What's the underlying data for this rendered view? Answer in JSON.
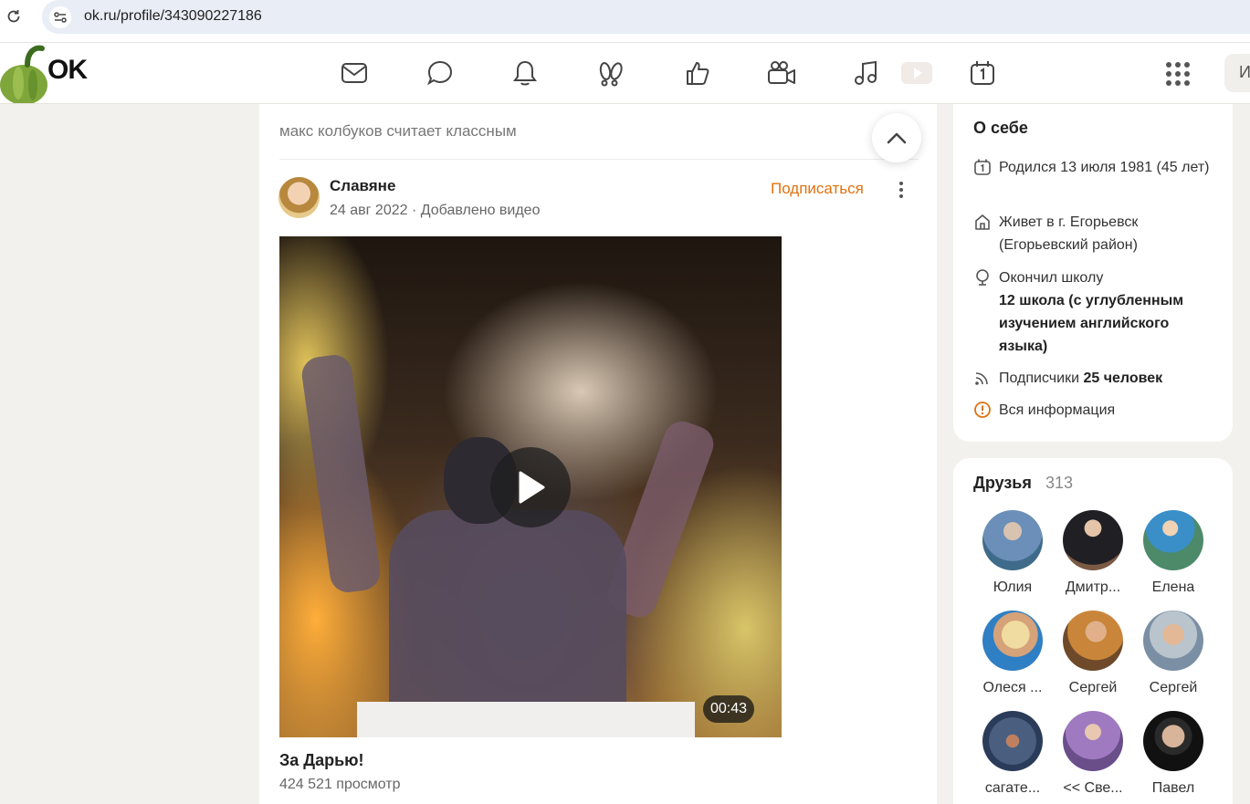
{
  "browser": {
    "url": "ok.ru/profile/343090227186"
  },
  "header": {
    "logo": "OK",
    "nav_icons": [
      "mail-icon",
      "chat-icon",
      "bell-icon",
      "guests-icon",
      "like-icon",
      "video-camera-icon",
      "music-icon",
      "video-play-icon",
      "calendar-icon"
    ],
    "search_stub": "И"
  },
  "feed": {
    "liked_line": "макс колбуков считает классным",
    "post": {
      "author": "Славяне",
      "date": "24 авг 2022",
      "action": "Добавлено видео",
      "subscribe_label": "Подписаться",
      "video_duration": "00:43",
      "video_title": "За Дарью!",
      "video_views": "424 521 просмотр"
    }
  },
  "about": {
    "title": "О себе",
    "born": "Родился 13 июля 1981 (45 лет)",
    "lives": "Живет в г. Егорьевск (Егорьевский район)",
    "school_prefix": "Окончил школу",
    "school_name": "12 школа (с углубленным изучением английского языка)",
    "subscribers_label": "Подписчики",
    "subscribers_value": "25 человек",
    "all_info": "Вся информация"
  },
  "friends": {
    "title": "Друзья",
    "count": "313",
    "list": [
      {
        "name": "Юлия",
        "color": "#6b8fb8"
      },
      {
        "name": "Дмитр...",
        "color": "#7b5a45"
      },
      {
        "name": "Елена",
        "color": "#4c8a6a"
      },
      {
        "name": "Олеся ...",
        "color": "#2f7fc4"
      },
      {
        "name": "Сергей",
        "color": "#c9853a"
      },
      {
        "name": "Сергей",
        "color": "#7a8fa3"
      },
      {
        "name": "сагате...",
        "color": "#2b3c5a"
      },
      {
        "name": "<< Све...",
        "color": "#a07ac0"
      },
      {
        "name": "Павел",
        "color": "#1a1a1a"
      }
    ]
  },
  "colors": {
    "accent": "#e0720f",
    "page_bg": "#f3f1ee"
  }
}
